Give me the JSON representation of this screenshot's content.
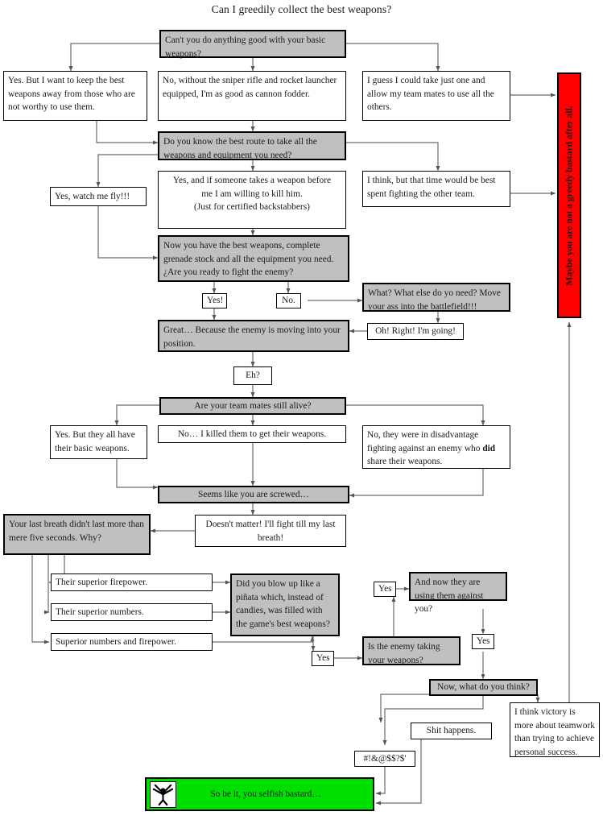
{
  "title": "Can I greedily collect the best weapons?",
  "colors": {
    "question_fill": "#c0c0c0",
    "answer_fill": "#ffffff",
    "bad_end_fill": "#ff0000",
    "good_end_fill": "#00e000",
    "stroke": "#000000"
  },
  "nodes": {
    "q_basic_weapons": "Can't you do anything good with your basic weapons?",
    "a_keep_away": "Yes. But I want to keep the best weapons away from those who are not worthy to use them.",
    "a_cannon_fodder": "No, without the sniper rifle and rocket launcher equipped, I'm as good as cannon fodder.",
    "a_take_just_one": "I guess I could take just one and allow my team mates to use all the others.",
    "q_best_route": "Do you know the best route to take all the weapons and equipment you need?",
    "a_watch_me_fly": "Yes, watch me fly!!!",
    "a_kill_him_l1": "Yes, and if someone takes a weapon before",
    "a_kill_him_l2": "me I am willing to kill him.",
    "a_kill_him_l3": "(Just for certified backstabbers)",
    "a_time_better_spent": "I think, but that time would be best spent fighting the other team.",
    "q_ready_to_fight": "Now you have the best weapons, complete grenade stock and all the equipment you need. ¿Are you ready to fight the enemy?",
    "lbl_yes_excl": "Yes!",
    "lbl_no": "No.",
    "a_what_else": "What? What else do yo need? Move your ass into the battlefield!!!",
    "a_oh_right": "Oh! Right! I'm going!",
    "q_enemy_moving": "Great… Because the enemy is moving into your position.",
    "lbl_eh": "Eh?",
    "q_team_mates_alive": "Are your team mates still alive?",
    "a_basic_weapons": "Yes. But they all have their basic weapons.",
    "a_killed_them": "No… I killed them to get their weapons.",
    "a_disadvantage_pre": "No, they were in disadvantage fighting against an enemy who ",
    "a_disadvantage_bold": "did",
    "a_disadvantage_post": " share their weapons.",
    "q_screwed": "Seems like you are screwed…",
    "a_last_breath": "Doesn't matter! I'll fight till my last breath!",
    "q_why": "Your last breath didn't last more than mere five seconds. Why?",
    "a_superior_firepower": "Their superior firepower.",
    "a_superior_numbers": "Their superior numbers.",
    "a_superior_both": "Superior numbers and firepower.",
    "q_pinata": "Did you blow up like a piñata which, instead of candies, was filled with the game's best weapons?",
    "lbl_yes_pinata": "Yes",
    "q_enemy_taking": "Is the enemy taking your weapons?",
    "lbl_yes_taking": "Yes",
    "q_using_against": "And now they are using them against you?",
    "lbl_yes_using": "Yes",
    "q_what_do_you_think": "Now, what do you think?",
    "a_shit_happens": "Shit happens.",
    "a_curse": "#!&@$$?$'",
    "a_teamwork": "I think victory is more about teamwork than trying to achieve personal success.",
    "end_bad": "Maybe you are not a greedy bastard after all.",
    "end_good": "So be it, you selfish bastard…",
    "end_good_icon": "stick-figure-with-weapons-icon"
  }
}
